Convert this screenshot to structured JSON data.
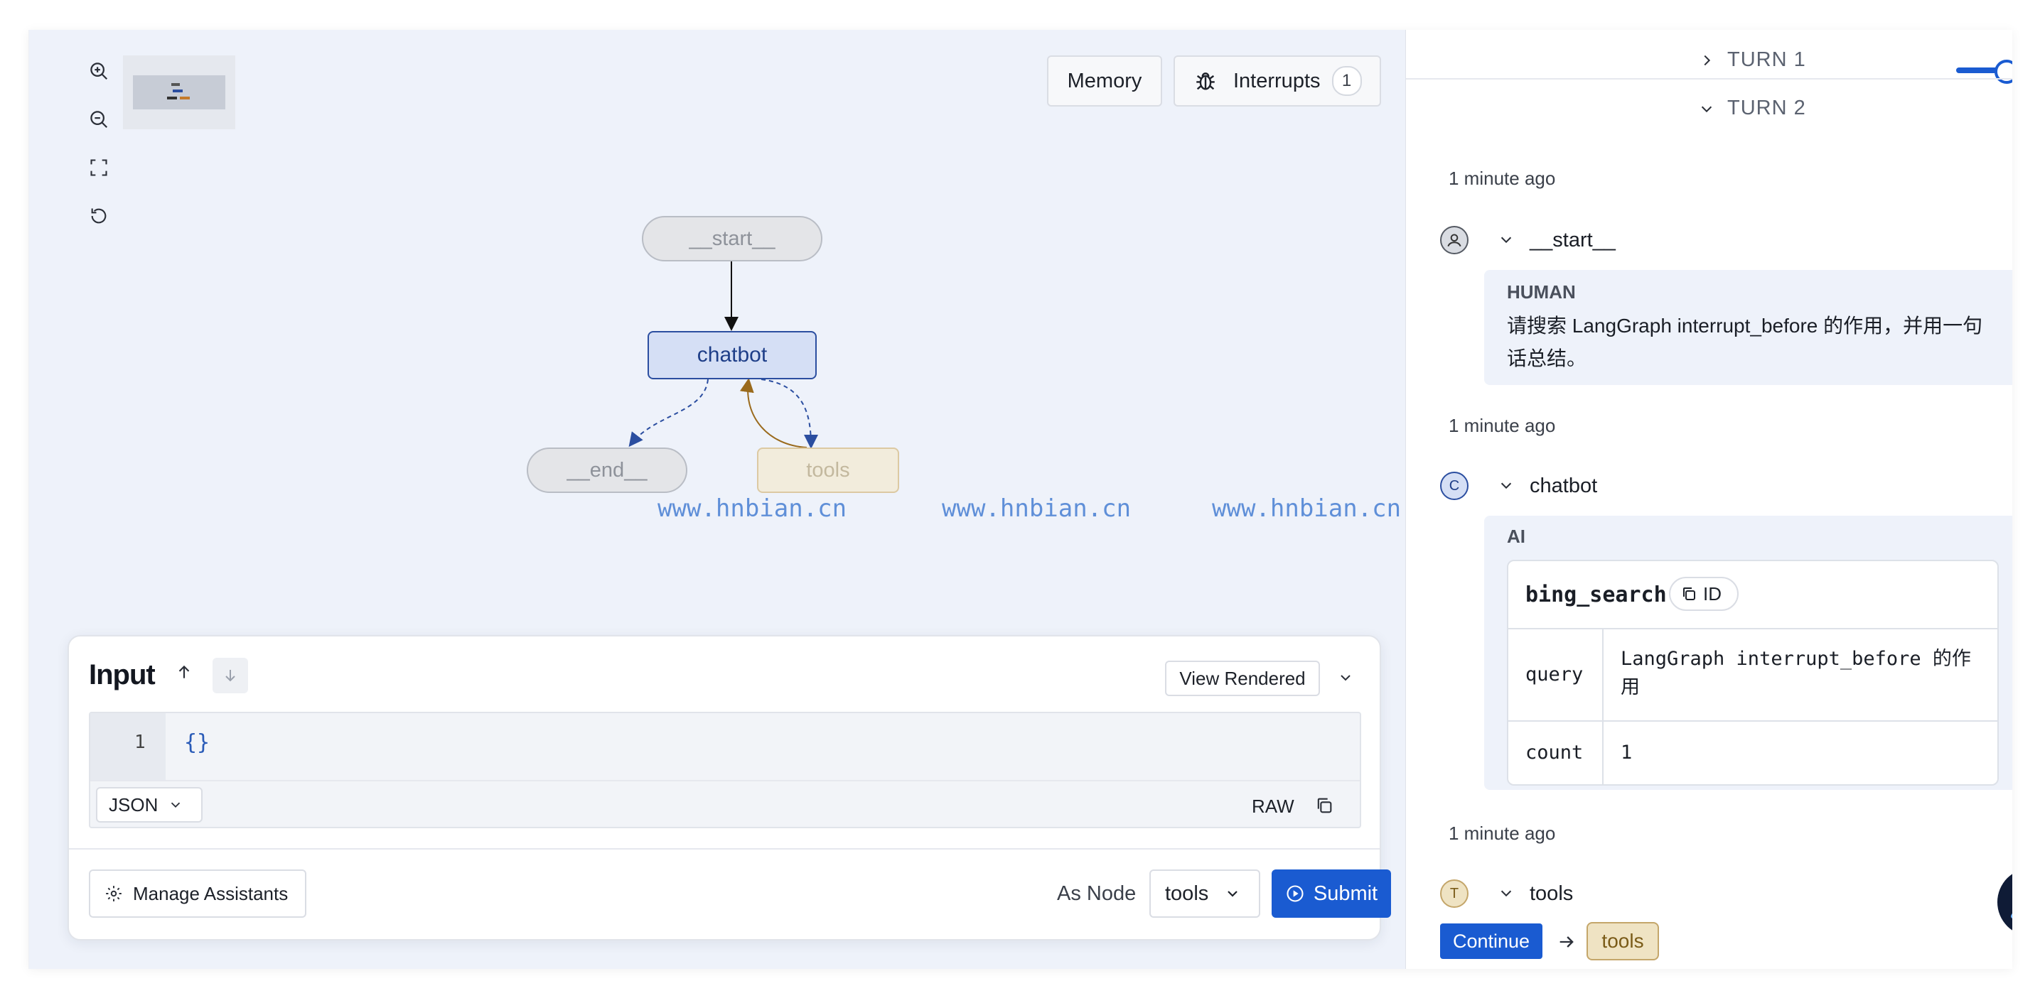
{
  "graph": {
    "buttons": {
      "memory": "Memory",
      "interrupts": "Interrupts",
      "interrupts_count": "1"
    },
    "nodes": {
      "start": "__start__",
      "chatbot": "chatbot",
      "end": "__end__",
      "tools": "tools"
    },
    "watermark": "www.hnbian.cn"
  },
  "input": {
    "title": "Input",
    "view_mode": "View Rendered",
    "line_number": "1",
    "code": "{}",
    "format": "JSON",
    "raw": "RAW",
    "manage_assistants": "Manage Assistants",
    "as_node_label": "As Node",
    "as_node_value": "tools",
    "submit": "Submit"
  },
  "thread": {
    "turns": [
      "TURN 1",
      "TURN 2"
    ],
    "steps": [
      {
        "time": "1 minute ago",
        "avatar": "",
        "name": "__start__",
        "role": "HUMAN",
        "message": "请搜索 LangGraph interrupt_before 的作用，并用一句话总结。"
      },
      {
        "time": "1 minute ago",
        "avatar": "C",
        "name": "chatbot",
        "role": "AI",
        "tool_call": {
          "name": "bing_search",
          "id_label": "ID",
          "args": [
            {
              "key": "query",
              "value": "LangGraph interrupt_before 的作用"
            },
            {
              "key": "count",
              "value": "1"
            }
          ]
        }
      },
      {
        "time": "1 minute ago",
        "avatar": "T",
        "name": "tools",
        "continue": "Continue",
        "next": "tools"
      }
    ]
  },
  "colors": {
    "accent": "#1a5bd1",
    "chatbot_node": "#d5dff5",
    "tools_tag": "#efe3c3"
  }
}
